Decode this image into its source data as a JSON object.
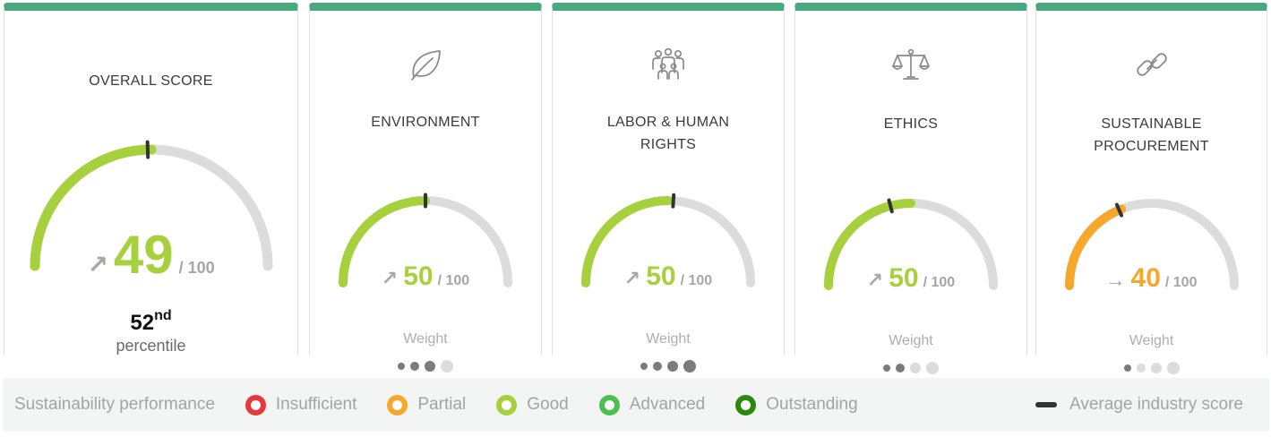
{
  "cards": [
    {
      "id": "overall",
      "title": "OVERALL SCORE",
      "icon": null,
      "score": 50,
      "score_text": "49",
      "out_of": "/ 100",
      "trend": "up",
      "trend_glyph": "↗",
      "color": "#a6d13c",
      "average_industry_score": 49,
      "percentile_rank": "52",
      "percentile_suffix": "nd",
      "percentile_label": "percentile"
    },
    {
      "id": "environment",
      "title": "ENVIRONMENT",
      "icon": "leaf-icon",
      "score": 50,
      "score_text": "50",
      "out_of": "/ 100",
      "trend": "up",
      "trend_glyph": "↗",
      "color": "#a6d13c",
      "average_industry_score": 50,
      "weight_label": "Weight",
      "weight": 3,
      "weight_max": 4
    },
    {
      "id": "labor-human-rights",
      "title": "LABOR & HUMAN\nRIGHTS",
      "icon": "people-icon",
      "score": 50,
      "score_text": "50",
      "out_of": "/ 100",
      "trend": "up",
      "trend_glyph": "↗",
      "color": "#a6d13c",
      "average_industry_score": 52,
      "weight_label": "Weight",
      "weight": 4,
      "weight_max": 4
    },
    {
      "id": "ethics",
      "title": "ETHICS",
      "icon": "scales-icon",
      "score": 50,
      "score_text": "50",
      "out_of": "/ 100",
      "trend": "up",
      "trend_glyph": "↗",
      "color": "#a6d13c",
      "average_industry_score": 42,
      "weight_label": "Weight",
      "weight": 2,
      "weight_max": 4
    },
    {
      "id": "sustainable-procurement",
      "title": "SUSTAINABLE\nPROCUREMENT",
      "icon": "link-icon",
      "score": 38,
      "score_text": "40",
      "out_of": "/ 100",
      "trend": "flat",
      "trend_glyph": "→",
      "color": "#f5a82b",
      "average_industry_score": 37,
      "weight_label": "Weight",
      "weight": 1,
      "weight_max": 4
    }
  ],
  "legend": {
    "title": "Sustainability performance",
    "items": [
      {
        "label": "Insufficient",
        "color": "#e8383d"
      },
      {
        "label": "Partial",
        "color": "#f5a82b"
      },
      {
        "label": "Good",
        "color": "#a6d13c"
      },
      {
        "label": "Advanced",
        "color": "#4cbf4f"
      },
      {
        "label": "Outstanding",
        "color": "#2b8a0e"
      }
    ],
    "average_label": "Average industry score"
  },
  "colors": {
    "card_top_border": "#47a97f",
    "gauge_track": "#dcdcdc",
    "industry_marker": "#333333"
  }
}
